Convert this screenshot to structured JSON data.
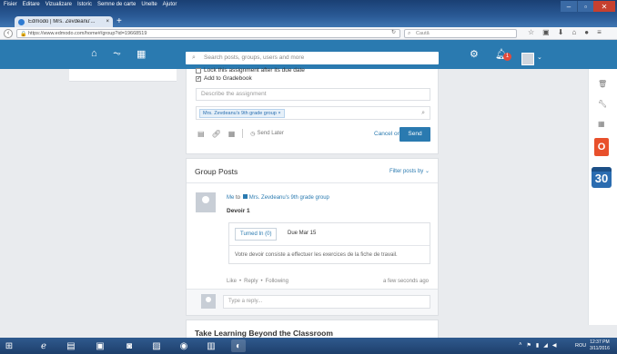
{
  "window": {
    "menu": [
      "Fisier",
      "Editare",
      "Vizualizare",
      "Istoric",
      "Semne de carte",
      "Unelte",
      "Ajutor"
    ],
    "tab_title": "Edmodo | Mrs. Zevdeanu'...",
    "tab_close": "×",
    "new_tab": "+",
    "url": "https://www.edmodo.com/home#/group?id=19668519",
    "search_placeholder": "Caută"
  },
  "header": {
    "search_placeholder": "Search posts, groups, users and more",
    "notification_count": "1"
  },
  "compose": {
    "lock_label": "Lock this assignment after its due date",
    "gradebook_label": "Add to Gradebook",
    "describe_placeholder": "Describe the assignment",
    "recipient_chip": "Mrs. Zevdeanu's 9th grade group",
    "chip_remove": "×",
    "send_later": "Send Later",
    "cancel": "Cancel or",
    "send": "Send"
  },
  "posts": {
    "title": "Group Posts",
    "filter": "Filter posts by ⌄",
    "post": {
      "sender": "Me",
      "to": "to",
      "group": "Mrs. Zevdeanu's 9th grade group",
      "title": "Devoir 1",
      "turned_in": "Turned In (0)",
      "due": "Due Mar 15",
      "description": "Votre devoir consiste a effectuer les exercices de la fiche de travail.",
      "like": "Like",
      "reply": "Reply",
      "following": "Following",
      "dot": "•",
      "time": "a few seconds ago",
      "reply_placeholder": "Type a reply..."
    }
  },
  "promo": {
    "title": "Take Learning Beyond the Classroom"
  },
  "taskbar": {
    "lang": "ROU",
    "time": "12:37 PM",
    "date": "3/11/2016"
  }
}
